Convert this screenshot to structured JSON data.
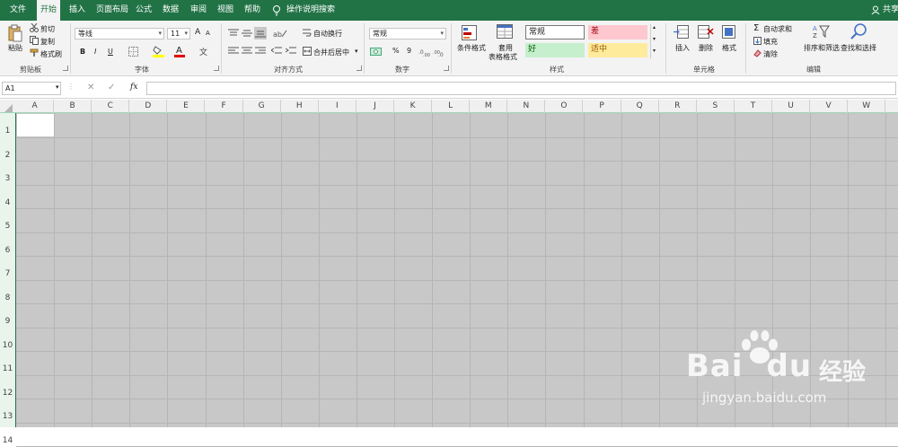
{
  "tabs": [
    "文件",
    "开始",
    "插入",
    "页面布局",
    "公式",
    "数据",
    "审阅",
    "视图",
    "帮助",
    "操作说明搜索"
  ],
  "share": "共享",
  "clipboard": {
    "paste": "粘贴",
    "cut": "剪切",
    "copy": "复制",
    "format_painter": "格式刷",
    "label": "剪贴板"
  },
  "font": {
    "name": "等线",
    "size": "11",
    "bold": "B",
    "italic": "I",
    "underline": "U",
    "grow": "A",
    "shrink": "A",
    "label": "字体"
  },
  "alignment": {
    "wrap": "自动换行",
    "merge": "合并后居中",
    "label": "对齐方式"
  },
  "number": {
    "format": "常规",
    "percent": "%",
    "comma": "9",
    "label": "数字"
  },
  "styles": {
    "conditional": "条件格式",
    "table_l1": "套用",
    "table_l2": "表格格式",
    "normal": "常规",
    "bad": "差",
    "good": "好",
    "neutral": "适中",
    "label": "样式"
  },
  "cells": {
    "insert": "插入",
    "delete": "删除",
    "format": "格式",
    "label": "单元格"
  },
  "editing": {
    "autosum": "自动求和",
    "fill": "填充",
    "clear": "清除",
    "sort": "排序和筛选",
    "find": "查找和选择",
    "label": "编辑"
  },
  "formula_bar": {
    "name_box": "A1",
    "cancel": "✕",
    "enter": "✓",
    "fx": "fx"
  },
  "columns": [
    "A",
    "B",
    "C",
    "D",
    "E",
    "F",
    "G",
    "H",
    "I",
    "J",
    "K",
    "L",
    "M",
    "N",
    "O",
    "P",
    "Q",
    "R",
    "S",
    "T",
    "U",
    "V",
    "W"
  ],
  "rows": [
    "1",
    "2",
    "3",
    "4",
    "5",
    "6",
    "7",
    "8",
    "9",
    "10",
    "11",
    "12",
    "13",
    "14"
  ],
  "watermark": {
    "brand": "Bai",
    "brand2": "du",
    "cn": "经验",
    "url": "jingyan.baidu.com"
  },
  "colors": {
    "accent": "#217346",
    "grid_bg": "#c8c8c8",
    "bad_bg": "#ffc7ce",
    "good_bg": "#c6efce",
    "neutral_bg": "#ffeb9c"
  }
}
